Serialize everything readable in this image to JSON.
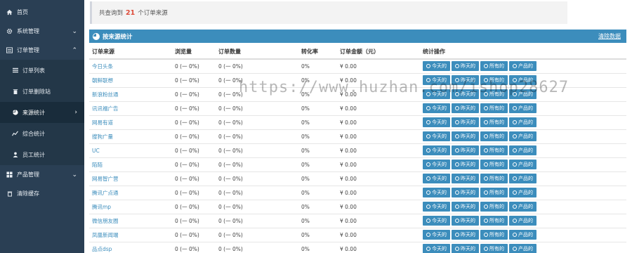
{
  "sidebar": {
    "items": [
      {
        "label": "首页",
        "icon": "home-icon"
      },
      {
        "label": "系统管理",
        "icon": "gear-icon",
        "arrow": "⌄"
      },
      {
        "label": "订单管理",
        "icon": "list-icon",
        "arrow": "⌃"
      },
      {
        "label": "订单列表",
        "icon": "bars-icon"
      },
      {
        "label": "订单删除站",
        "icon": "trash-icon"
      },
      {
        "label": "来源统计",
        "icon": "pie-icon",
        "arrow": "›"
      },
      {
        "label": "综合统计",
        "icon": "chart-icon"
      },
      {
        "label": "员工统计",
        "icon": "user-icon"
      },
      {
        "label": "产品管理",
        "icon": "grid-icon",
        "arrow": "⌄"
      },
      {
        "label": "清除缓存",
        "icon": "bin-icon"
      }
    ]
  },
  "notice": {
    "prefix": "共查询到",
    "count": "21",
    "suffix": "个订单来源"
  },
  "panel": {
    "title": "按来源统计",
    "clear_label": "清除数据"
  },
  "table": {
    "headers": [
      "订单来源",
      "浏览量",
      "订单数量",
      "转化率",
      "订单金额（元）",
      "统计操作"
    ],
    "buttons": [
      "今天的",
      "昨天的",
      "所有的",
      "产品的"
    ],
    "rows": [
      {
        "source": "今日头条",
        "views": "0 (一 0%)",
        "orders": "0 (一 0%)",
        "rate": "0%",
        "amount": "¥ 0.00"
      },
      {
        "source": "朝鲜联想",
        "views": "0 (一 0%)",
        "orders": "0 (一 0%)",
        "rate": "0%",
        "amount": "¥ 0.00"
      },
      {
        "source": "新浪粉丝通",
        "views": "0 (一 0%)",
        "orders": "0 (一 0%)",
        "rate": "0%",
        "amount": "¥ 0.00"
      },
      {
        "source": "讯讯福广告",
        "views": "0 (一 0%)",
        "orders": "0 (一 0%)",
        "rate": "0%",
        "amount": "¥ 0.00"
      },
      {
        "source": "网易有道",
        "views": "0 (一 0%)",
        "orders": "0 (一 0%)",
        "rate": "0%",
        "amount": "¥ 0.00"
      },
      {
        "source": "搜狗广量",
        "views": "0 (一 0%)",
        "orders": "0 (一 0%)",
        "rate": "0%",
        "amount": "¥ 0.00"
      },
      {
        "source": "UC",
        "views": "0 (一 0%)",
        "orders": "0 (一 0%)",
        "rate": "0%",
        "amount": "¥ 0.00"
      },
      {
        "source": "陌陌",
        "views": "0 (一 0%)",
        "orders": "0 (一 0%)",
        "rate": "0%",
        "amount": "¥ 0.00"
      },
      {
        "source": "网易智广营",
        "views": "0 (一 0%)",
        "orders": "0 (一 0%)",
        "rate": "0%",
        "amount": "¥ 0.00"
      },
      {
        "source": "腾讯广点通",
        "views": "0 (一 0%)",
        "orders": "0 (一 0%)",
        "rate": "0%",
        "amount": "¥ 0.00"
      },
      {
        "source": "腾讯mp",
        "views": "0 (一 0%)",
        "orders": "0 (一 0%)",
        "rate": "0%",
        "amount": "¥ 0.00"
      },
      {
        "source": "微信朋友圈",
        "views": "0 (一 0%)",
        "orders": "0 (一 0%)",
        "rate": "0%",
        "amount": "¥ 0.00"
      },
      {
        "source": "凤凰新闻端",
        "views": "0 (一 0%)",
        "orders": "0 (一 0%)",
        "rate": "0%",
        "amount": "¥ 0.00"
      },
      {
        "source": "品点dsp",
        "views": "0 (一 0%)",
        "orders": "0 (一 0%)",
        "rate": "0%",
        "amount": "¥ 0.00"
      }
    ]
  },
  "watermark": "https://www.huzhan.com/ishop28627"
}
